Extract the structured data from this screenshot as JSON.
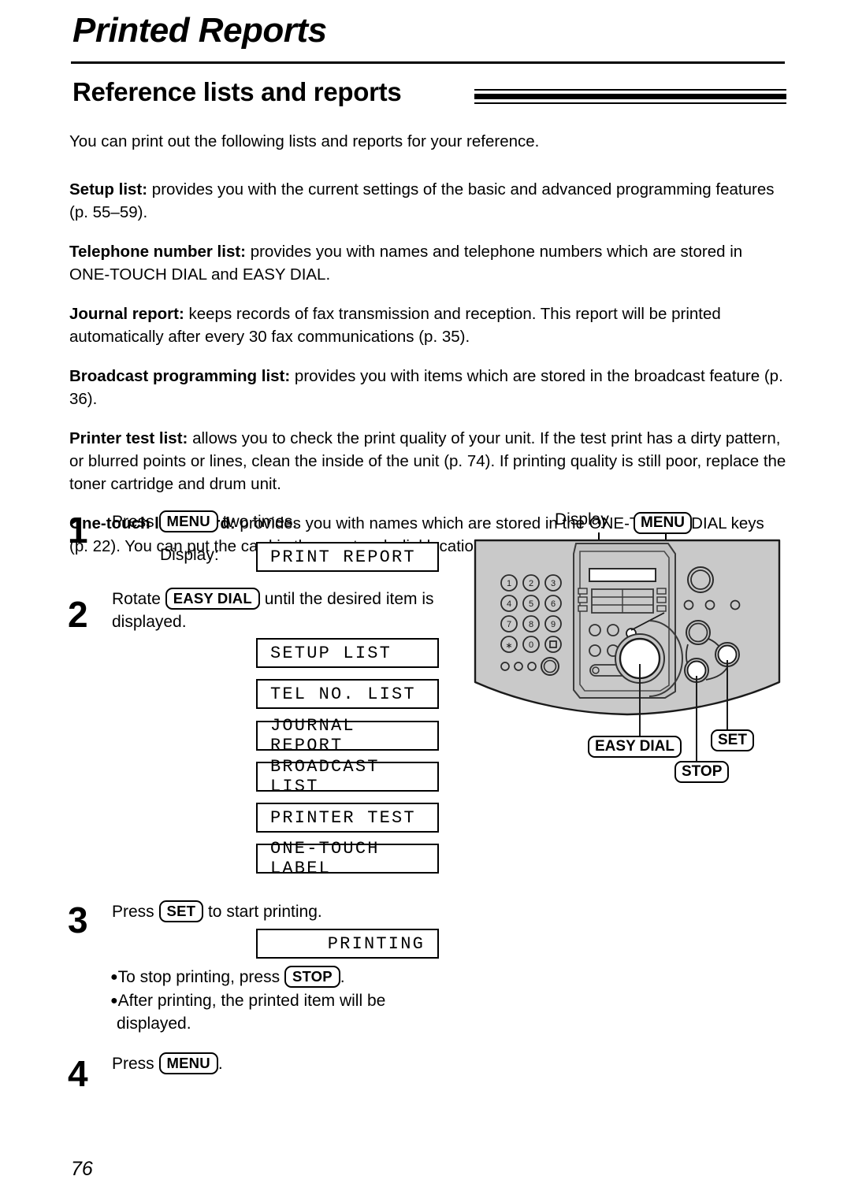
{
  "header": {
    "chapter_title": "Printed Reports",
    "section_title": "Reference lists and reports"
  },
  "body": {
    "intro": "You can print out the following lists and reports for your reference.",
    "paragraphs": [
      {
        "term": "Setup list:",
        "text": " provides you with the current settings of the basic and advanced programming features (p. 55–59)."
      },
      {
        "term": "Telephone number list:",
        "text": " provides you with names and telephone numbers which are stored in ONE-TOUCH DIAL and EASY DIAL."
      },
      {
        "term": "Journal report:",
        "text": " keeps records of fax transmission and reception. This report will be printed automatically after every 30 fax communications (p. 35)."
      },
      {
        "term": "Broadcast programming list:",
        "text": " provides you with items which are stored in the broadcast feature (p. 36)."
      },
      {
        "term": "Printer test list:",
        "text": " allows you to check the print quality of your unit. If the test print has a dirty pattern, or blurred points or lines, clean the inside of the unit (p. 74). If printing quality is still poor, replace the toner cartridge and drum unit."
      },
      {
        "term": "One-touch label card:",
        "text": " provides you with names which are stored in the ONE-TOUCH DIAL keys (p. 22). You can put the card in the one-touch dial location."
      }
    ]
  },
  "steps": {
    "step1": {
      "number": "1",
      "text_before": "Press",
      "key": "MENU",
      "text_after": "two times.",
      "display_label": "Display:",
      "lcd": "PRINT REPORT"
    },
    "step2": {
      "number": "2",
      "text_before": "Rotate",
      "key": "EASY DIAL",
      "text_after": "until the desired item is",
      "text_line2": "displayed.",
      "lcd_items": [
        "SETUP LIST",
        "TEL NO. LIST",
        "JOURNAL REPORT",
        "BROADCAST LIST",
        "PRINTER TEST",
        "ONE-TOUCH LABEL"
      ]
    },
    "step3": {
      "number": "3",
      "text_before": "Press",
      "key": "SET",
      "text_after": "to start printing.",
      "lcd": "PRINTING",
      "bullet1_before": "To stop printing, press",
      "bullet1_key": "STOP",
      "bullet1_after": ".",
      "bullet2_line1": "After printing, the printed item will be",
      "bullet2_line2": "displayed."
    },
    "step4": {
      "number": "4",
      "text_before": "Press",
      "key": "MENU",
      "text_after": "."
    }
  },
  "figure": {
    "callouts": {
      "display": "Display",
      "menu": "MENU",
      "easy_dial": "EASY DIAL",
      "stop": "STOP",
      "set": "SET"
    },
    "keypad": [
      "1",
      "2",
      "3",
      "4",
      "5",
      "6",
      "7",
      "8",
      "9",
      "∗",
      "0",
      "⧉"
    ]
  },
  "footer": {
    "page_number": "76"
  }
}
